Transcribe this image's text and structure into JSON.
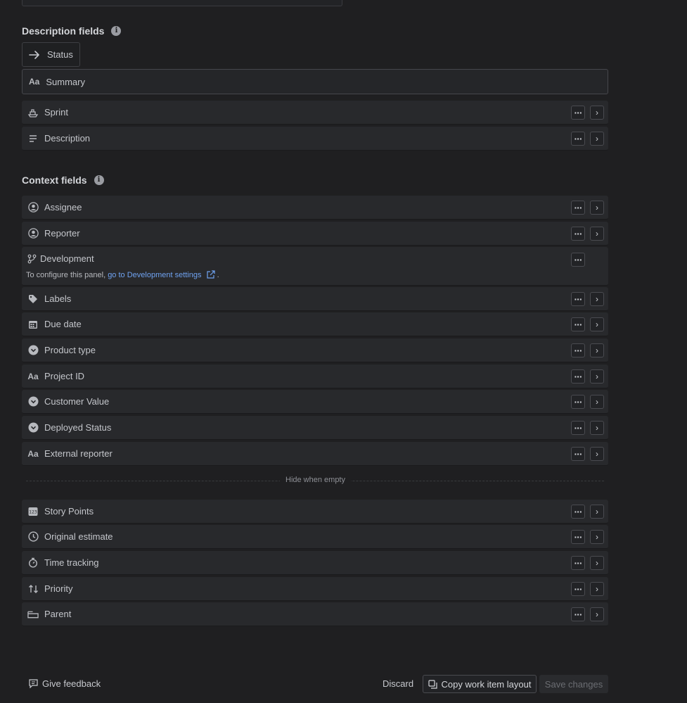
{
  "description_section": {
    "title": "Description fields",
    "status_label": "Status",
    "summary_label": "Summary",
    "rows": [
      {
        "label": "Sprint",
        "icon": "sprint-icon"
      },
      {
        "label": "Description",
        "icon": "description-icon"
      }
    ]
  },
  "context_section": {
    "title": "Context fields",
    "rows": [
      {
        "label": "Assignee",
        "icon": "user-icon"
      },
      {
        "label": "Reporter",
        "icon": "user-icon"
      }
    ],
    "development": {
      "label": "Development",
      "note_prefix": "To configure this panel, ",
      "link": "go to Development settings",
      "note_suffix": "."
    },
    "rows_after": [
      {
        "label": "Labels",
        "icon": "tag-icon"
      },
      {
        "label": "Due date",
        "icon": "calendar-icon"
      },
      {
        "label": "Product type",
        "icon": "dropdown-icon"
      },
      {
        "label": "Project ID",
        "icon": "text-icon"
      },
      {
        "label": "Customer Value",
        "icon": "dropdown-icon"
      },
      {
        "label": "Deployed Status",
        "icon": "dropdown-icon"
      },
      {
        "label": "External reporter",
        "icon": "text-icon"
      }
    ]
  },
  "hide_when_empty": {
    "label": "Hide when empty",
    "rows": [
      {
        "label": "Story Points",
        "icon": "number-icon"
      },
      {
        "label": "Original estimate",
        "icon": "clock-icon"
      },
      {
        "label": "Time tracking",
        "icon": "stopwatch-icon"
      },
      {
        "label": "Priority",
        "icon": "priority-icon"
      },
      {
        "label": "Parent",
        "icon": "parent-icon"
      }
    ]
  },
  "footer": {
    "feedback": "Give feedback",
    "discard": "Discard",
    "copy": "Copy work item layout",
    "save": "Save changes"
  }
}
